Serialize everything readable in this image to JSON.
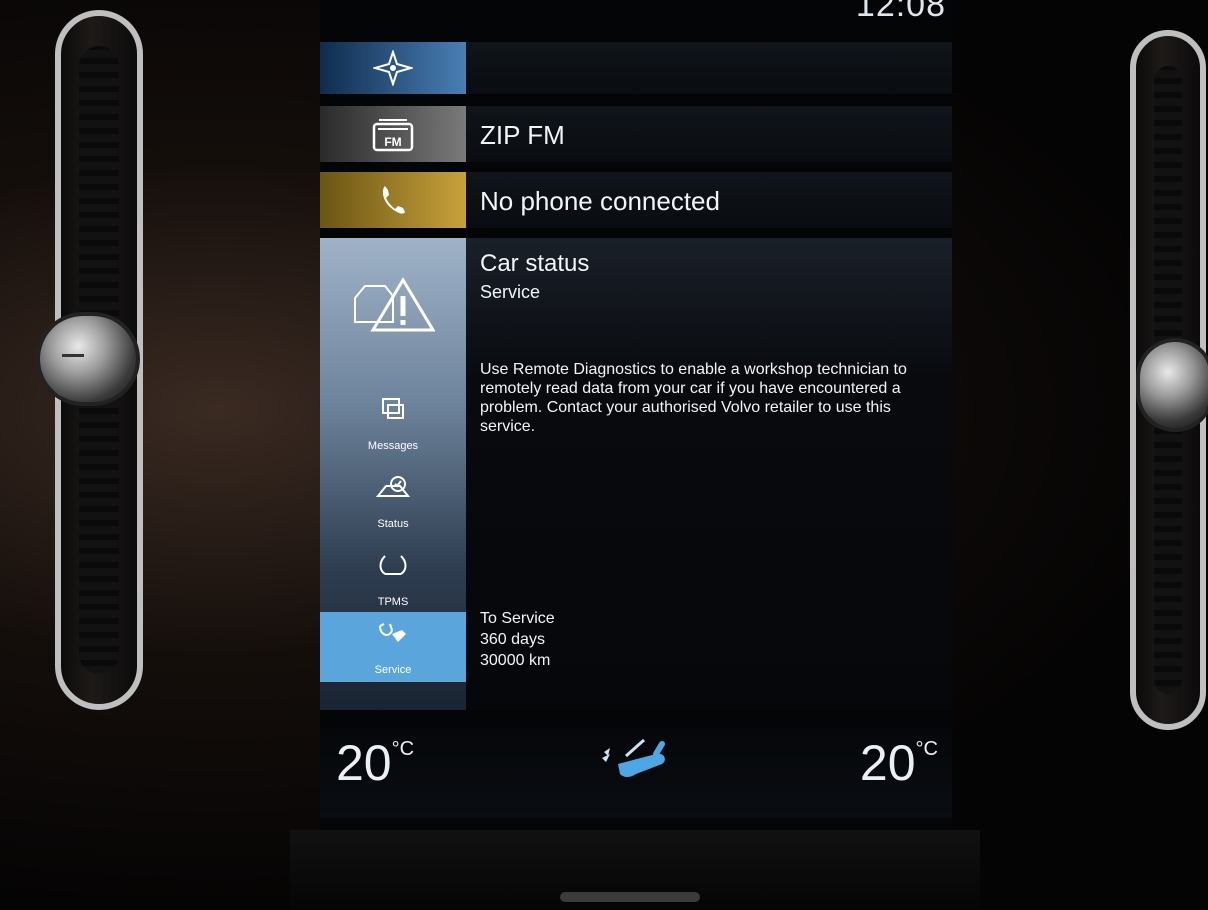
{
  "status_bar": {
    "time": "12:08"
  },
  "tiles": {
    "navigation": {
      "icon": "compass-icon",
      "title": ""
    },
    "media": {
      "icon": "radio-fm-icon",
      "icon_label": "FM",
      "title": "ZIP FM"
    },
    "phone": {
      "icon": "phone-icon",
      "title": "No phone connected"
    }
  },
  "car_status": {
    "title": "Car status",
    "subtitle": "Service",
    "description": "Use Remote Diagnostics to enable a workshop technician to remotely read data from your car if you have encountered a problem. Contact your authorised Volvo retailer to use this service.",
    "to_service_label": "To Service",
    "days": "360 days",
    "distance": "30000 km",
    "side_nav": [
      {
        "label": "Messages",
        "icon": "messages-icon",
        "active": false
      },
      {
        "label": "Status",
        "icon": "status-icon",
        "active": false
      },
      {
        "label": "TPMS",
        "icon": "tpms-icon",
        "active": false
      },
      {
        "label": "Service",
        "icon": "service-icon",
        "active": true
      }
    ]
  },
  "climate": {
    "left_temp": "20",
    "right_temp": "20",
    "unit": "°C"
  },
  "colors": {
    "nav_accent": "#4a7fb5",
    "phone_accent": "#c8a13a",
    "active_tab": "#5aa6dc"
  }
}
